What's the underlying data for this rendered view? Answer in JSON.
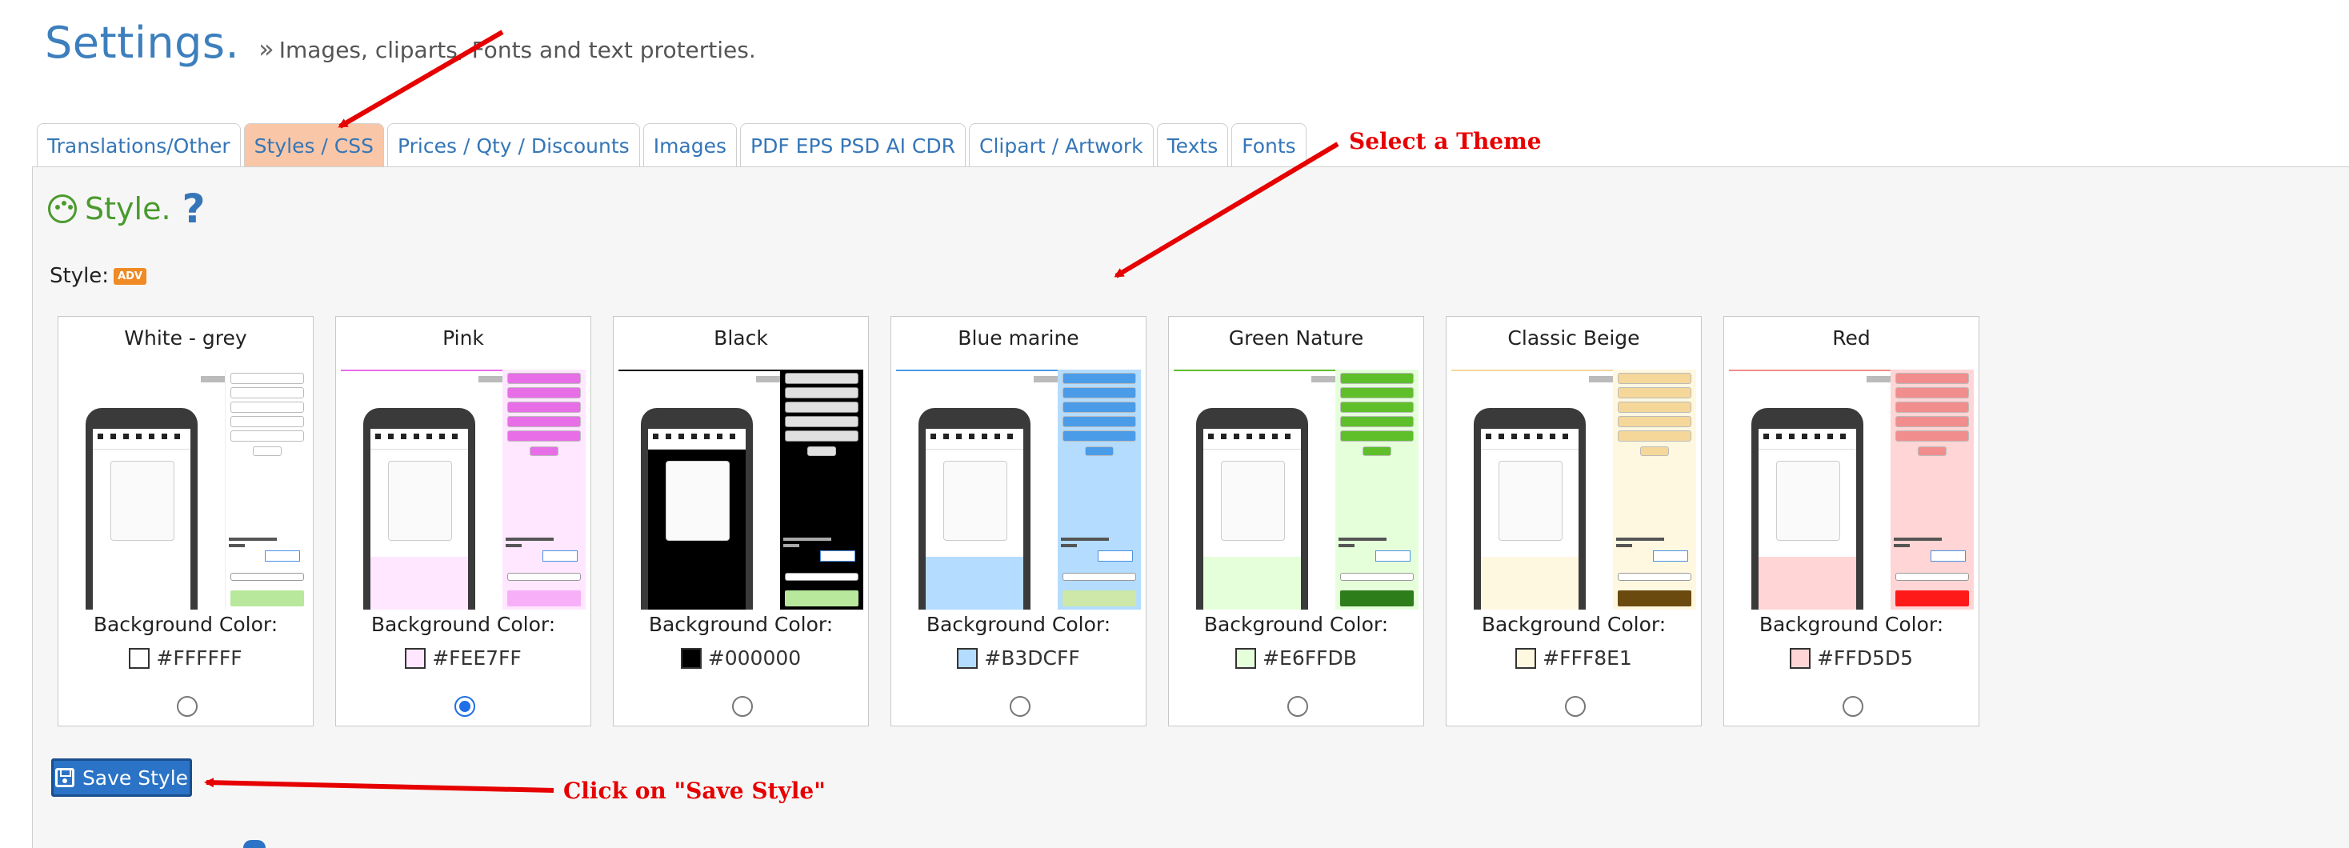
{
  "header": {
    "title": "Settings.",
    "subtitle": "Images, cliparts, Fonts and text proterties."
  },
  "tabs": [
    {
      "label": "Translations/Other",
      "active": false
    },
    {
      "label": "Styles / CSS",
      "active": true
    },
    {
      "label": "Prices / Qty / Discounts",
      "active": false
    },
    {
      "label": "Images",
      "active": false
    },
    {
      "label": "PDF EPS PSD AI CDR",
      "active": false
    },
    {
      "label": "Clipart / Artwork",
      "active": false
    },
    {
      "label": "Texts",
      "active": false
    },
    {
      "label": "Fonts",
      "active": false
    }
  ],
  "section": {
    "title": "Style.",
    "help_symbol": "?",
    "style_label": "Style:",
    "adv_badge": "ADV"
  },
  "themes": [
    {
      "name": "White - grey",
      "bg_label": "Background Color:",
      "hex": "#FFFFFF",
      "color": "#FFFFFF",
      "accent": "#ffffff",
      "selected": false
    },
    {
      "name": "Pink",
      "bg_label": "Background Color:",
      "hex": "#FEE7FF",
      "color": "#FEE7FF",
      "accent": "#e86ee8",
      "selected": true
    },
    {
      "name": "Black",
      "bg_label": "Background Color:",
      "hex": "#000000",
      "color": "#000000",
      "accent": "#e0e0e0",
      "selected": false
    },
    {
      "name": "Blue marine",
      "bg_label": "Background Color:",
      "hex": "#B3DCFF",
      "color": "#B3DCFF",
      "accent": "#4a9ce8",
      "selected": false
    },
    {
      "name": "Green Nature",
      "bg_label": "Background Color:",
      "hex": "#E6FFDB",
      "color": "#E6FFDB",
      "accent": "#5fbf2a",
      "selected": false
    },
    {
      "name": "Classic Beige",
      "bg_label": "Background Color:",
      "hex": "#FFF8E1",
      "color": "#FFF8E1",
      "accent": "#f5d79a",
      "selected": false
    },
    {
      "name": "Red",
      "bg_label": "Background Color:",
      "hex": "#FFD5D5",
      "color": "#FFD5D5",
      "accent": "#f28d8d",
      "selected": false
    }
  ],
  "save_button": {
    "label": "Save Style",
    "icon": "floppy-disk-icon"
  },
  "annotations": {
    "select_theme": "Select a Theme",
    "click_save": "Click on \"Save Style\""
  },
  "colors": {
    "link_blue": "#3576b8",
    "active_tab": "#f9c7a8",
    "style_green": "#4a9a2e",
    "annotation_red": "#e60000",
    "button_blue": "#2a73c6"
  }
}
